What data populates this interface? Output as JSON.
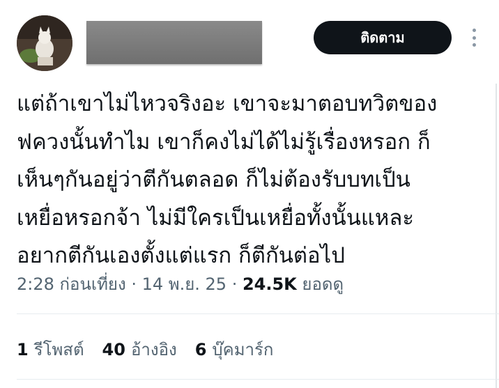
{
  "header": {
    "follow_label": "ติดตาม"
  },
  "tweet": {
    "text": "แต่ถ้าเขาไม่ไหวจริงอะ เขาจะมาตอบทวิตของ\nฟควงนั้นทำไม เขาก็คงไม่ได้ไม่รู้เรื่องหรอก ก็\nเห็นๆกันอยู่ว่าตีกันตลอด ก็ไม่ต้องรับบทเป็น\nเหยื่อหรอกจ้า ไม่มีใครเป็นเหยื่อทั้งนั้นแหละ\nอยากตีกันเองตั้งแต่แรก ก็ตีกันต่อไป"
  },
  "meta": {
    "time": "2:28 ก่อนเที่ยง",
    "separator": " · ",
    "date": "14 พ.ย. 25",
    "views_count": "24.5K",
    "views_label": "ยอดดู"
  },
  "stats": {
    "reposts_count": "1",
    "reposts_label": "รีโพสต์",
    "quotes_count": "40",
    "quotes_label": "อ้างอิง",
    "bookmarks_count": "6",
    "bookmarks_label": "บุ๊คมาร์ก"
  },
  "icons": {
    "more": "more-horizontal-icon"
  }
}
